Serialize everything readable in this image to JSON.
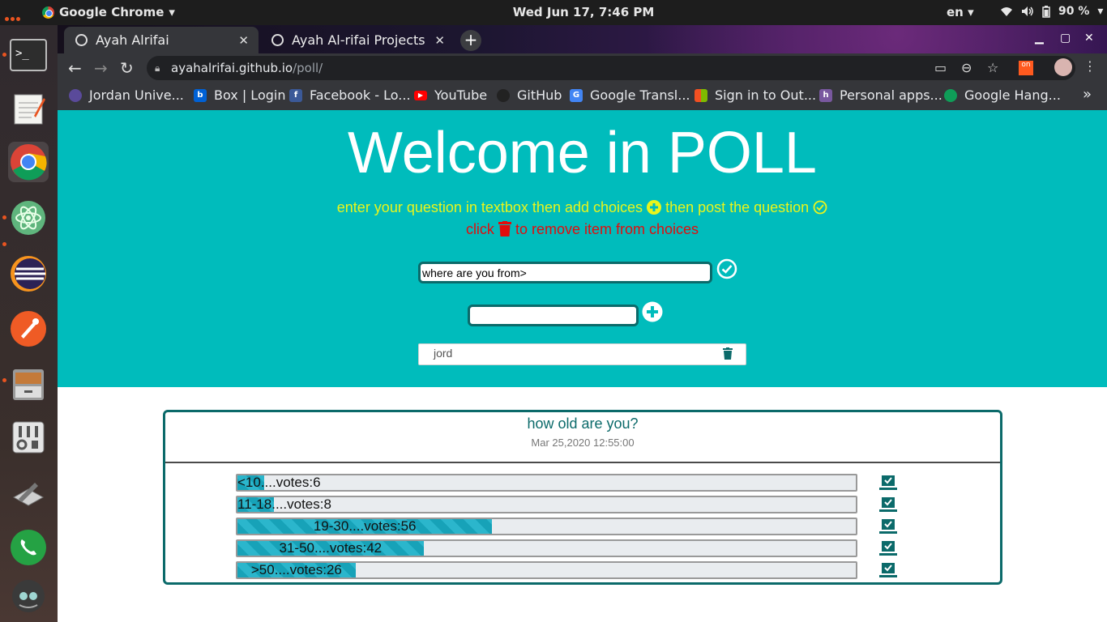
{
  "os": {
    "app_name": "Google Chrome",
    "clock": "Wed Jun 17,  7:46 PM",
    "lang": "en",
    "battery": "90 %"
  },
  "browser": {
    "tabs": [
      {
        "label": "Ayah Alrifai",
        "active": true
      },
      {
        "label": "Ayah Al-rifai Projects",
        "active": false
      }
    ],
    "url_host": "ayahalrifai.github.io",
    "url_path": "/poll/",
    "bookmarks": [
      {
        "label": "Jordan Unive...",
        "icon": "jordan-university-icon",
        "color": "#5a4a9a"
      },
      {
        "label": "Box | Login",
        "icon": "box-icon",
        "color": "#0061d5"
      },
      {
        "label": "Facebook - Lo...",
        "icon": "facebook-icon",
        "color": "#3b5998"
      },
      {
        "label": "YouTube",
        "icon": "youtube-icon",
        "color": "#ff0000"
      },
      {
        "label": "GitHub",
        "icon": "github-icon",
        "color": "#222222"
      },
      {
        "label": "Google Transl...",
        "icon": "google-translate-icon",
        "color": "#4285f4"
      },
      {
        "label": "Sign in to Out...",
        "icon": "microsoft-icon",
        "color": "#f25022"
      },
      {
        "label": "Personal apps...",
        "icon": "heroku-icon",
        "color": "#79589f"
      },
      {
        "label": "Google Hang...",
        "icon": "hangouts-icon",
        "color": "#0f9d58"
      }
    ]
  },
  "page": {
    "title": "Welcome in POLL",
    "instruction_1a": "enter your question in textbox then add choices",
    "instruction_1b": "then post the question",
    "instruction_2a": "click",
    "instruction_2b": "to remove item from choices",
    "question_value": "where are you from>",
    "choice_value": "",
    "choices": [
      {
        "label": "jord"
      }
    ],
    "colors": {
      "hero": "#00bcbc",
      "accent_yellow": "#e8f51c",
      "accent_red": "#e20c0c",
      "dark_teal": "#0b6a6a"
    }
  },
  "poll": {
    "question": "how old are you?",
    "date": "Mar 25,2020 12:55:00",
    "options": [
      {
        "label": "<10....votes:6",
        "votes": 6,
        "percent": 4.3
      },
      {
        "label": "11-18....votes:8",
        "votes": 8,
        "percent": 5.9
      },
      {
        "label": "19-30....votes:56",
        "votes": 56,
        "percent": 41.2
      },
      {
        "label": "31-50....votes:42",
        "votes": 42,
        "percent": 30.1
      },
      {
        "label": ">50....votes:26",
        "votes": 26,
        "percent": 19.1
      }
    ]
  }
}
